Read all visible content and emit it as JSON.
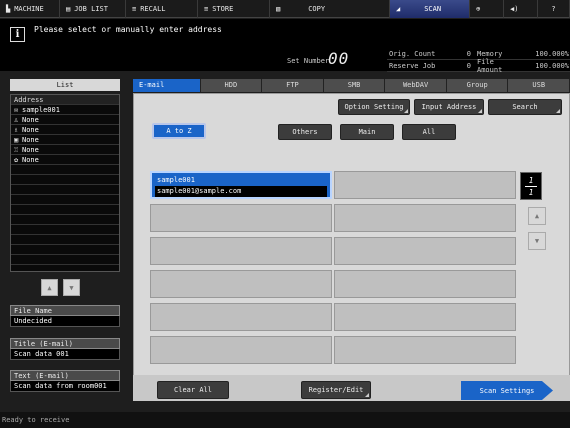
{
  "topbar": {
    "tabs": [
      {
        "label": "MACHINE",
        "icon": "machine-icon"
      },
      {
        "label": "JOB LIST",
        "icon": "job-list-icon"
      },
      {
        "label": "RECALL",
        "icon": "recall-icon"
      },
      {
        "label": "STORE",
        "icon": "store-icon"
      },
      {
        "label": "COPY",
        "icon": "copy-icon"
      },
      {
        "label": "SCAN",
        "icon": "scan-icon"
      },
      {
        "label": "",
        "icon": "network-icon"
      },
      {
        "label": "",
        "icon": "volume-icon"
      },
      {
        "label": "?",
        "icon": "help-icon"
      }
    ]
  },
  "message": {
    "text": "Please select or manually enter address",
    "set_number_label": "Set Number",
    "set_number_value": "00"
  },
  "counters": {
    "orig_count_label": "Orig. Count",
    "orig_count_value": "0",
    "memory_label": "Memory",
    "memory_value": "100.000%",
    "reserve_job_label": "Reserve Job",
    "reserve_job_value": "0",
    "file_amount_label": "File Amount",
    "file_amount_value": "100.000%"
  },
  "left": {
    "list_header": "List",
    "address_header": "Address",
    "rows": [
      {
        "icon": "email-icon",
        "glyph": "✉",
        "label": "sample001"
      },
      {
        "icon": "user-icon",
        "glyph": "♙",
        "label": "None"
      },
      {
        "icon": "group-icon",
        "glyph": "♗",
        "label": "None"
      },
      {
        "icon": "box-icon",
        "glyph": "▣",
        "label": "None"
      },
      {
        "icon": "server-icon",
        "glyph": "♖",
        "label": "None"
      },
      {
        "icon": "webdav-icon",
        "glyph": "✿",
        "label": "None"
      },
      {
        "icon": "",
        "glyph": "",
        "label": ""
      },
      {
        "icon": "",
        "glyph": "",
        "label": ""
      },
      {
        "icon": "",
        "glyph": "",
        "label": ""
      },
      {
        "icon": "",
        "glyph": "",
        "label": ""
      },
      {
        "icon": "",
        "glyph": "",
        "label": ""
      },
      {
        "icon": "",
        "glyph": "",
        "label": ""
      },
      {
        "icon": "",
        "glyph": "",
        "label": ""
      },
      {
        "icon": "",
        "glyph": "",
        "label": ""
      },
      {
        "icon": "",
        "glyph": "",
        "label": ""
      },
      {
        "icon": "",
        "glyph": "",
        "label": ""
      }
    ],
    "up_glyph": "▲",
    "down_glyph": "▼",
    "file_name_label": "File Name",
    "file_name_value": "Undecided",
    "title_label": "Title (E-mail)",
    "title_value": "Scan data 001",
    "text_label": "Text (E-mail)",
    "text_value": "Scan data from room001"
  },
  "dest_tabs": [
    "E-mail",
    "HDD",
    "FTP",
    "SMB",
    "WebDAV",
    "Group",
    "USB"
  ],
  "actions": {
    "option_setting": "Option Setting",
    "input_address": "Input Address",
    "search": "Search"
  },
  "index": {
    "a_to_z": "A to Z",
    "others": "Others",
    "main": "Main",
    "all": "All"
  },
  "entries": [
    {
      "name": "sample001",
      "email": "sample001@sample.com"
    }
  ],
  "page": {
    "current": "1",
    "total": "1",
    "up_glyph": "▲",
    "down_glyph": "▼"
  },
  "bottom": {
    "clear_all": "Clear All",
    "register_edit": "Register/Edit",
    "scan_settings": "Scan Settings"
  },
  "status": "Ready to receive",
  "colors": {
    "accent": "#1a64c8",
    "panel": "#d9d9d9"
  }
}
